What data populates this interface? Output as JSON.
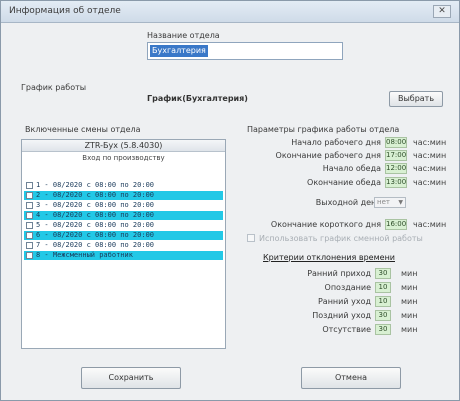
{
  "window": {
    "title": "Информация об отделе",
    "close_glyph": "✕"
  },
  "department": {
    "name_label": "Название отдела",
    "name_value": "Бухгалтерия"
  },
  "schedule": {
    "label": "График работы",
    "name": "График(Бухгалтерия)",
    "select_button": "Выбрать"
  },
  "shifts": {
    "label": "Включенные смены отдела",
    "header": "ZTR-Бух (5.8.4030)",
    "sub": "Вход по производству",
    "rows": [
      {
        "text": "1 - 08/2020 с 08:00 по 20:00",
        "highlight": false
      },
      {
        "text": "2 - 08/2020 с 08:00 по 20:00",
        "highlight": true
      },
      {
        "text": "3 - 08/2020 с 08:00 по 20:00",
        "highlight": false
      },
      {
        "text": "4 - 08/2020 с 08:00 по 20:00",
        "highlight": true
      },
      {
        "text": "5 - 08/2020 с 08:00 по 20:00",
        "highlight": false
      },
      {
        "text": "6 - 08/2020 с 08:00 по 20:00",
        "highlight": true
      },
      {
        "text": "7 - 08/2020 с 08:00 по 20:00",
        "highlight": false
      },
      {
        "text": "8 - Межсменный работник",
        "highlight": true
      }
    ]
  },
  "params": {
    "title": "Параметры графика работы отдела",
    "rows": [
      {
        "label": "Начало рабочего дня",
        "value": "08:00",
        "unit": "час:мин"
      },
      {
        "label": "Окончание рабочего дня",
        "value": "17:00",
        "unit": "час:мин"
      },
      {
        "label": "Начало обеда",
        "value": "12:00",
        "unit": "час:мин"
      },
      {
        "label": "Окончание обеда",
        "value": "13:00",
        "unit": "час:мин"
      }
    ],
    "weekend_label": "Выходной день",
    "weekend_value": "нет",
    "short_day_label": "Окончание короткого дня",
    "short_day_value": "16:00",
    "short_day_unit": "час:мин",
    "individual_label": "Использовать график сменной работы",
    "deviations_title": "Критерии отклонения времени",
    "deviations": [
      {
        "label": "Ранний приход",
        "value": "30",
        "unit": "мин"
      },
      {
        "label": "Опоздание",
        "value": "10",
        "unit": "мин"
      },
      {
        "label": "Ранний уход",
        "value": "10",
        "unit": "мин"
      },
      {
        "label": "Поздний уход",
        "value": "30",
        "unit": "мин"
      },
      {
        "label": "Отсутствие",
        "value": "30",
        "unit": "мин"
      }
    ]
  },
  "footer": {
    "save_button": "Сохранить",
    "cancel_button": "Отмена"
  },
  "colors": {
    "cyan_row": "#22c8e6",
    "selection": "#3a78c8",
    "field_green": "#d8f0d2"
  }
}
